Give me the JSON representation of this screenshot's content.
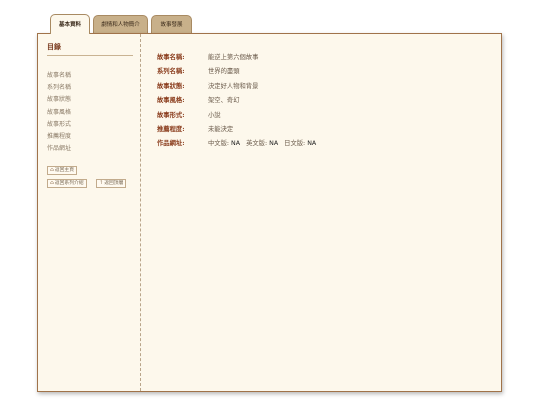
{
  "tabs": [
    {
      "label": "基本資料",
      "active": true
    },
    {
      "label": "劇情和人物簡介",
      "active": false
    },
    {
      "label": "故事發展",
      "active": false
    }
  ],
  "sidebar": {
    "title": "目錄",
    "items": [
      "故事名稱",
      "系列名稱",
      "故事狀態",
      "故事風格",
      "故事形式",
      "推薦程度",
      "作品網址"
    ],
    "buttons": {
      "home": "返回主頁",
      "series": "返回系列介紹",
      "top": "返回頂層"
    }
  },
  "info": {
    "rows": [
      {
        "label": "故事名稱:",
        "value": "能逆上第六個故事"
      },
      {
        "label": "系列名稱:",
        "value": "世界的盡頭"
      },
      {
        "label": "故事狀態:",
        "value": "決定好人物和背景"
      },
      {
        "label": "故事風格:",
        "value": "架空、奇幻"
      },
      {
        "label": "故事形式:",
        "value": "小說"
      },
      {
        "label": "推薦程度:",
        "value": "未能決定"
      }
    ],
    "url": {
      "label": "作品網址:",
      "zh_label": "中文版:",
      "zh": "NA",
      "en_label": "英文版:",
      "en": "NA",
      "jp_label": "日文版:",
      "jp": "NA"
    }
  },
  "colors": {
    "tab_inactive": "#c8b08a",
    "panel_bg": "#fdf8ec",
    "label": "#8a3c1c",
    "border": "#a0734a"
  },
  "icons": {
    "home": "home-icon",
    "arrow": "arrow-up-icon"
  }
}
